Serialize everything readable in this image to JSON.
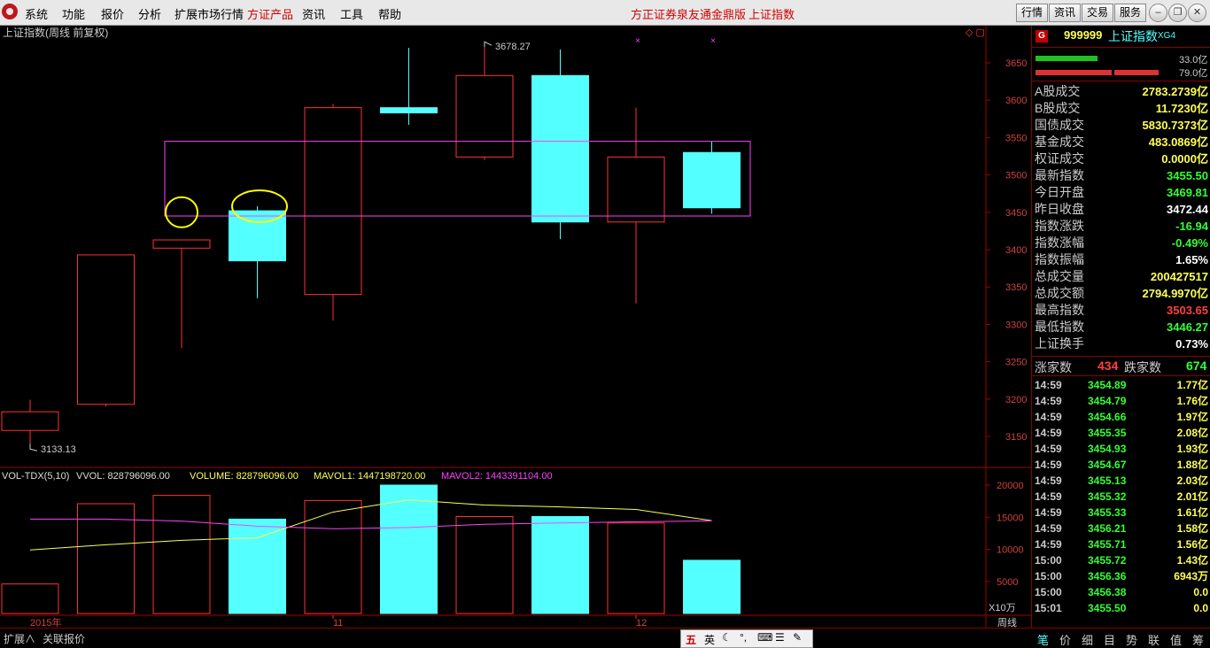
{
  "menu": {
    "items": [
      "系统",
      "功能",
      "报价",
      "分析",
      "扩展市场行情",
      "方证产品",
      "资讯",
      "工具",
      "帮助"
    ],
    "center_title": "方正证券泉友通金鼎版",
    "center_title_index": "上证指数",
    "right_buttons": [
      "行情",
      "资讯",
      "交易",
      "服务"
    ]
  },
  "chart": {
    "title": "上证指数(周线 前复权)",
    "price_ticks": [
      "3650",
      "3600",
      "3550",
      "3500",
      "3450",
      "3400",
      "3350",
      "3300",
      "3250",
      "3200",
      "3150"
    ],
    "annotation_high": "3678.27",
    "annotation_low": "3133.13",
    "indicator_line": {
      "name": "VOL-TDX(5,10)",
      "vvol": "VVOL: 828796096.00",
      "volume": "VOLUME: 828796096.00",
      "mavol1": "MAVOL1: 1447198720.00",
      "mavol2": "MAVOL2: 1443391104.00"
    },
    "vol_ticks": [
      "20000",
      "15000",
      "10000",
      "5000"
    ],
    "vol_unit": "X10万",
    "date_labels": [
      "2015年",
      "11",
      "12"
    ],
    "period_label": "周线",
    "colors": {
      "up": "#ff3232",
      "down": "#54ffff",
      "ma1": "#ffff55",
      "ma2": "#ff40ff",
      "box": "#ff40ff",
      "circle": "#ffff00"
    }
  },
  "chart_data": {
    "type": "candlestick",
    "title": "上证指数(周线 前复权)",
    "ylim": [
      3110,
      3700
    ],
    "candles": [
      {
        "open": 3158,
        "high": 3199,
        "low": 3133.13,
        "close": 3183
      },
      {
        "open": 3193,
        "high": 3393,
        "low": 3190,
        "close": 3393
      },
      {
        "open": 3402,
        "high": 3408,
        "low": 3268,
        "close": 3413
      },
      {
        "open": 3452,
        "high": 3458,
        "low": 3335,
        "close": 3385
      },
      {
        "open": 3340,
        "high": 3595,
        "low": 3305,
        "close": 3590
      },
      {
        "open": 3590,
        "high": 3670,
        "low": 3567,
        "close": 3583
      },
      {
        "open": 3524,
        "high": 3678.27,
        "low": 3520,
        "close": 3633
      },
      {
        "open": 3633,
        "high": 3668,
        "low": 3414,
        "close": 3437
      },
      {
        "open": 3437,
        "high": 3590,
        "low": 3328,
        "close": 3524
      },
      {
        "open": 3530,
        "high": 3545,
        "low": 3448,
        "close": 3456
      }
    ],
    "volume": {
      "ylim": [
        0,
        20000
      ],
      "values": [
        4600,
        17100,
        18400,
        14700,
        17600,
        20000,
        15100,
        15100,
        14100,
        8288
      ],
      "up": [
        true,
        true,
        true,
        false,
        true,
        false,
        true,
        false,
        true,
        false
      ],
      "mavol1": [
        9900,
        10700,
        11400,
        11800,
        15800,
        17700,
        16900,
        16600,
        16200,
        14472
      ],
      "mavol2": [
        14700,
        14700,
        14400,
        13600,
        13200,
        13400,
        13900,
        14100,
        14300,
        14434
      ]
    }
  },
  "quote": {
    "code": "999999",
    "name": "上证指数",
    "tag": "XG4",
    "badge": "G",
    "bar1_val": "33.0亿",
    "bar2_val": "79.0亿",
    "rows": [
      {
        "label": "A股成交",
        "value": "2783.2739亿",
        "color": "#ffff55"
      },
      {
        "label": "B股成交",
        "value": "11.7230亿",
        "color": "#ffff55"
      },
      {
        "label": "国债成交",
        "value": "5830.7373亿",
        "color": "#ffff55"
      },
      {
        "label": "基金成交",
        "value": "483.0869亿",
        "color": "#ffff55"
      },
      {
        "label": "权证成交",
        "value": "0.0000亿",
        "color": "#ffff55"
      },
      {
        "label": "最新指数",
        "value": "3455.50",
        "color": "#33ff33"
      },
      {
        "label": "今日开盘",
        "value": "3469.81",
        "color": "#33ff33"
      },
      {
        "label": "昨日收盘",
        "value": "3472.44",
        "color": "#ffffff"
      },
      {
        "label": "指数涨跌",
        "value": "-16.94",
        "color": "#33ff33"
      },
      {
        "label": "指数涨幅",
        "value": "-0.49%",
        "color": "#33ff33"
      },
      {
        "label": "指数振幅",
        "value": "1.65%",
        "color": "#ffffff"
      },
      {
        "label": "总成交量",
        "value": "200427517",
        "color": "#ffff55"
      },
      {
        "label": "总成交额",
        "value": "2794.9970亿",
        "color": "#ffff55"
      },
      {
        "label": "最高指数",
        "value": "3503.65",
        "color": "#ff4040"
      },
      {
        "label": "最低指数",
        "value": "3446.27",
        "color": "#33ff33"
      },
      {
        "label": "上证换手",
        "value": "0.73%",
        "color": "#ffffff"
      }
    ],
    "up_label": "涨家数",
    "up_count": "434",
    "down_label": "跌家数",
    "down_count": "674",
    "ticks": [
      {
        "time": "14:59",
        "price": "3454.89",
        "vol": "1.77亿"
      },
      {
        "time": "14:59",
        "price": "3454.79",
        "vol": "1.76亿"
      },
      {
        "time": "14:59",
        "price": "3454.66",
        "vol": "1.97亿"
      },
      {
        "time": "14:59",
        "price": "3455.35",
        "vol": "2.08亿"
      },
      {
        "time": "14:59",
        "price": "3454.93",
        "vol": "1.93亿"
      },
      {
        "time": "14:59",
        "price": "3454.67",
        "vol": "1.88亿"
      },
      {
        "time": "14:59",
        "price": "3455.13",
        "vol": "2.03亿"
      },
      {
        "time": "14:59",
        "price": "3455.32",
        "vol": "2.01亿"
      },
      {
        "time": "14:59",
        "price": "3455.33",
        "vol": "1.61亿"
      },
      {
        "time": "14:59",
        "price": "3456.21",
        "vol": "1.58亿"
      },
      {
        "time": "14:59",
        "price": "3455.71",
        "vol": "1.56亿"
      },
      {
        "time": "15:00",
        "price": "3455.72",
        "vol": "1.43亿"
      },
      {
        "time": "15:00",
        "price": "3456.36",
        "vol": "6943万"
      },
      {
        "time": "15:00",
        "price": "3456.38",
        "vol": "0.0"
      },
      {
        "time": "15:01",
        "price": "3455.50",
        "vol": "0.0"
      }
    ]
  },
  "bottom": {
    "left_tabs": [
      "扩展∧",
      "关联报价"
    ],
    "ime": [
      "五",
      "英"
    ],
    "panel_tabs": [
      "笔",
      "价",
      "细",
      "目",
      "势",
      "联",
      "值",
      "筹"
    ]
  }
}
